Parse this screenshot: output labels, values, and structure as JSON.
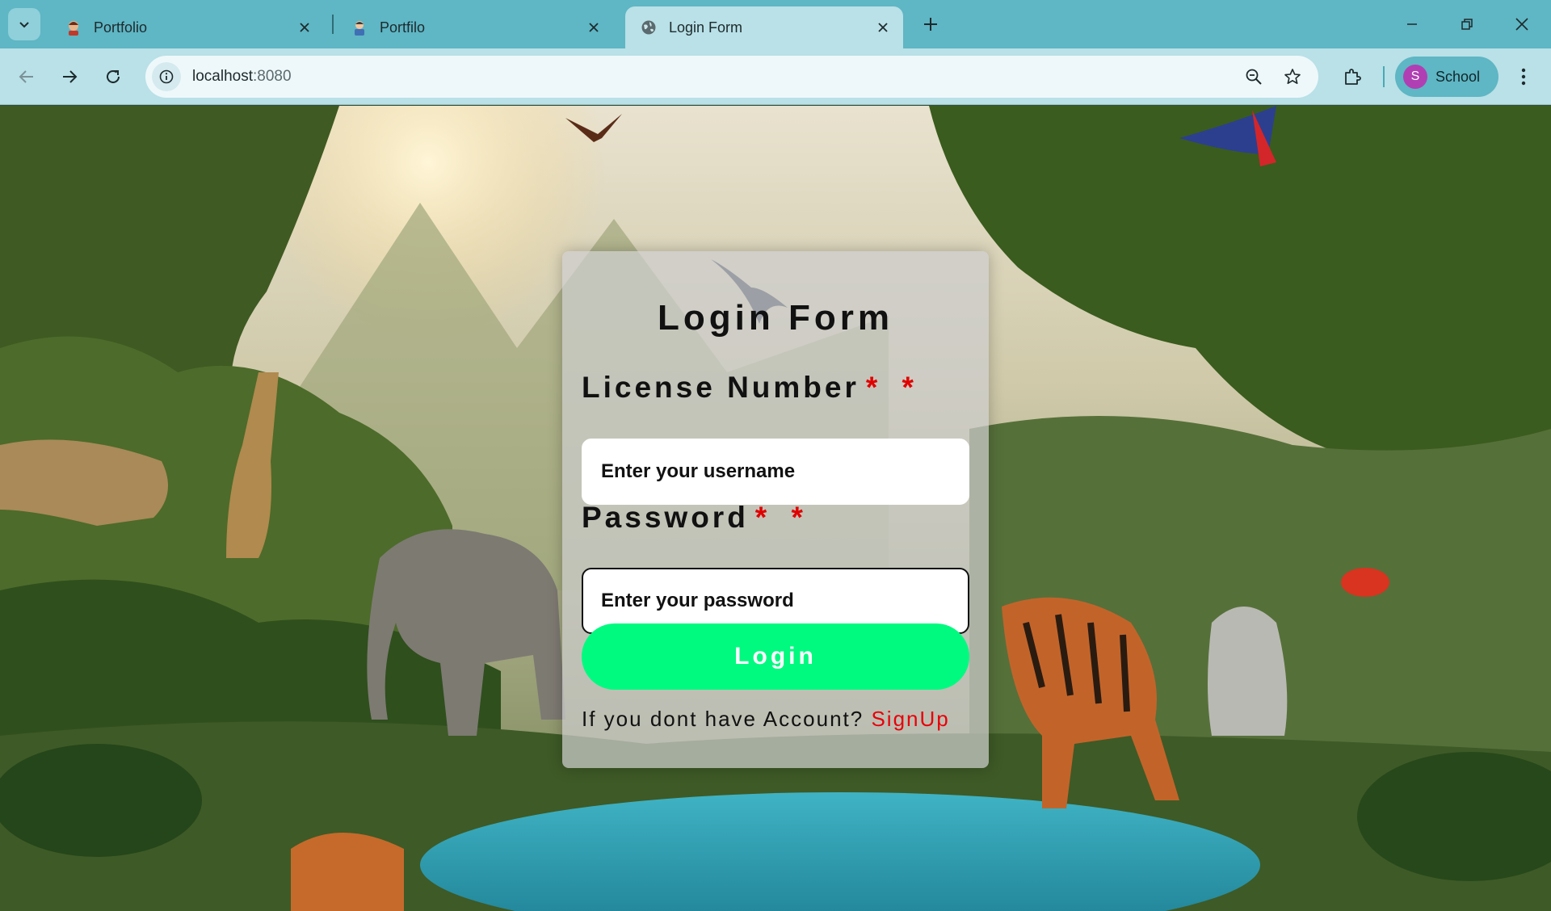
{
  "browser": {
    "tabs": [
      {
        "title": "Portfolio",
        "favicon": "portrait-icon",
        "active": false
      },
      {
        "title": "Portfilo",
        "favicon": "portrait-icon",
        "active": false
      },
      {
        "title": "Login Form",
        "favicon": "globe-icon",
        "active": true
      }
    ],
    "url_host": "localhost",
    "url_port": ":8080",
    "profile_initial": "S",
    "profile_name": "School",
    "colors": {
      "tabbar": "#5fb6c4",
      "toolbar": "#b9e1e7",
      "avatar": "#b13fb4"
    }
  },
  "page": {
    "background": "jungle-animals-illustration",
    "login_form": {
      "title": "Login Form",
      "license_label": "License Number",
      "license_required": "* *",
      "license_placeholder": "Enter your username",
      "password_label": "Password",
      "password_required": "* *",
      "password_placeholder": "Enter your password",
      "login_button": "Login",
      "signup_prompt": "If you dont have Account? ",
      "signup_link": "SignUp",
      "colors": {
        "button": "#00fa80",
        "required": "#e00000",
        "link": "#e8000a"
      }
    }
  }
}
